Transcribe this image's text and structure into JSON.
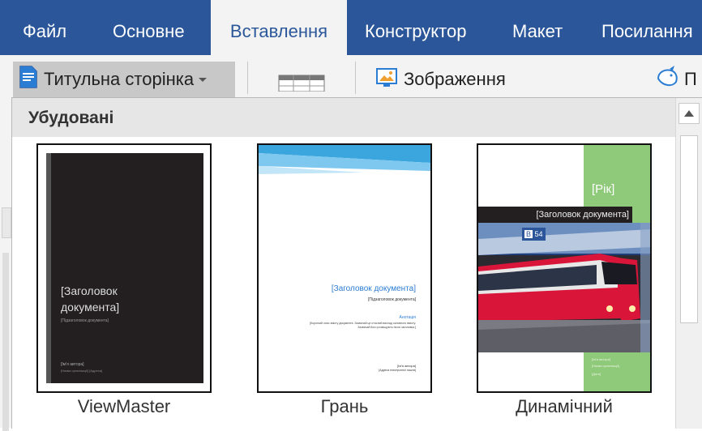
{
  "ribbon": {
    "tabs": [
      {
        "label": "Файл"
      },
      {
        "label": "Основне"
      },
      {
        "label": "Вставлення"
      },
      {
        "label": "Конструктор"
      },
      {
        "label": "Макет"
      },
      {
        "label": "Посилання"
      }
    ],
    "active_tab": "Вставлення"
  },
  "toolbar": {
    "cover_page_label": "Титульна сторінка",
    "pictures_label": "Зображення",
    "partial_label": "П"
  },
  "gallery": {
    "section_title": "Убудовані",
    "items": [
      {
        "name": "ViewMaster",
        "title_placeholder_line1": "[Заголовок",
        "title_placeholder_line2": "документа]",
        "subtitle_placeholder": "[Підзаголовок документа]",
        "author_placeholder": "[Ім'я автора]",
        "meta_placeholder": "[Назва організації] [Адреса]"
      },
      {
        "name": "Грань",
        "title_placeholder": "[Заголовок документа]",
        "subtitle_placeholder": "[Підзаголовок документа]",
        "abstract_label": "Анотація",
        "abstract_text_1": "[Короткий опис змісту документа. Зазвичай це стислий виклад основного вмісту.",
        "abstract_text_2": "Зазвичай його розміщують після заголовка.]",
        "author_placeholder": "[Ім'я автора]",
        "email_placeholder": "[Адреса електронної пошти]"
      },
      {
        "name": "Динамічний",
        "year_placeholder": "[Рік]",
        "title_placeholder": "[Заголовок документа]",
        "train_number_1": "B",
        "train_number_2": "54",
        "author_placeholder": "[Ім'я автора]",
        "company_placeholder": "[Назва організації]",
        "date_placeholder": "[Дата]"
      }
    ]
  },
  "colors": {
    "ribbon_blue": "#2b579a",
    "viewmaster_bg": "#231f20",
    "facet_blue": "#3aa6dd",
    "motion_green": "#8fc97a",
    "motion_train_red": "#d9163a"
  }
}
